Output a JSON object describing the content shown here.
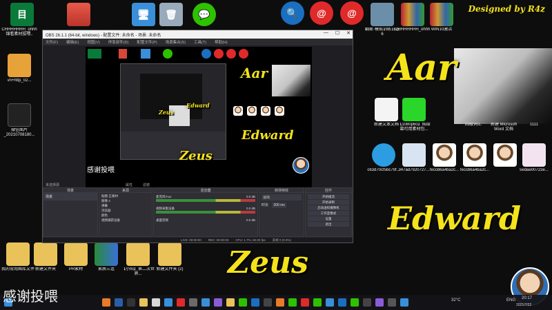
{
  "watermark": "Designed by R4z",
  "overlay": {
    "name1": "Aar",
    "name2": "Edward",
    "name3": "Zeus",
    "thanks": "感谢投喂"
  },
  "desktop": {
    "left_icons": [
      {
        "label": "CHHHHHHH_ohhh锦看素材投喂.."
      },
      {
        "label": "vn+http_02..."
      },
      {
        "label": "微信图片_20210708180..."
      }
    ],
    "right_icons": [
      {
        "label": "微信图片_20210716122..."
      },
      {
        "label": "新建文本文档"
      },
      {
        "label": "【1080p60】纯绿幕可用素材包..."
      },
      {
        "label": "四级词汇"
      },
      {
        "label": "新建 Microsoft Word 文档"
      },
      {
        "label": "1111"
      }
    ],
    "top_right_icons": [
      {
        "label": "翻斯·模拟训练日志 6"
      },
      {
        "label": "CHHHHHHH_ohhh..."
      },
      {
        "label": "WIN10激活"
      }
    ],
    "avatar_row_labels": [
      {
        "label": "c63d70cf5bc79f..."
      },
      {
        "label": "347ad7920727..."
      },
      {
        "label": "feccb6a4ba2c..."
      },
      {
        "label": "feccb6a4ba2c..."
      },
      {
        "label": "5edae00723e..."
      }
    ],
    "bottom_icons": [
      {
        "label": "我的常用图库文件"
      },
      {
        "label": "新建文件夹"
      },
      {
        "label": "PR素材"
      },
      {
        "label": "素质三连"
      },
      {
        "label": "【小阳】第二次世界..."
      },
      {
        "label": "新建文件夹 (2)"
      }
    ]
  },
  "obs": {
    "title": "OBS 26.1.1 (64-bit, windows) - 配置文件: 未命名 - 场景: 未命名",
    "menu": [
      "文件(F)",
      "编辑(E)",
      "视图(V)",
      "停靠部件(D)",
      "配置文件(P)",
      "场景集合(S)",
      "工具(T)",
      "帮助(H)"
    ],
    "preview_label": "未选择源",
    "preview_props": "属性",
    "preview_filters": "滤镜",
    "panels": {
      "scenes": {
        "title": "场景",
        "items": [
          "场景"
        ]
      },
      "sources": {
        "title": "来源",
        "items": [
          "贴图·正素材",
          "图像 2",
          "弹幕",
          "浏览器",
          "颜色",
          "视频捕获设备"
        ]
      },
      "mixer": {
        "title": "混音器",
        "channels": [
          {
            "name": "麦克风/Aux",
            "value": "0.0 dB"
          },
          {
            "name": "视频采集设备",
            "value": "0.0 dB"
          },
          {
            "name": "桌面音频",
            "value": "0.0 dB"
          }
        ]
      },
      "transitions": {
        "title": "转场特效",
        "type": "淡出",
        "duration_label": "时长",
        "duration": "300 ms"
      },
      "controls": {
        "title": "控件",
        "buttons": [
          "开始推流",
          "开始录制",
          "启动虚拟摄像机",
          "工作室模式",
          "设置",
          "退出"
        ]
      }
    },
    "status": {
      "live": "LIVE: 00:00:00",
      "rec": "REC: 00:00:00",
      "cpu": "CPU: 1.7%, 60.00 fps",
      "dropped": "丢帧 0 (0.0%)"
    }
  },
  "taskbar": {
    "temp": "32°C",
    "lang": "ENG",
    "time": "20:17",
    "date": "2021/7/22"
  },
  "colors": {
    "accent_yellow": "#f4e21a",
    "obs_bg": "#1f1f23"
  }
}
